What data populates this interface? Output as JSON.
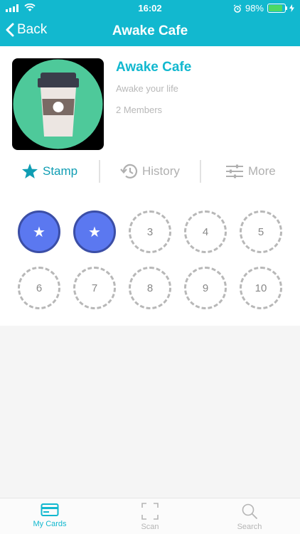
{
  "status_bar": {
    "time": "16:02",
    "battery": "98%"
  },
  "nav": {
    "back_label": "Back",
    "title": "Awake Cafe"
  },
  "cafe": {
    "name": "Awake Cafe",
    "tagline": "Awake your life",
    "members": "2 Members"
  },
  "tabs": {
    "stamp": "Stamp",
    "history": "History",
    "more": "More"
  },
  "stamps": {
    "filled_count": 2,
    "slots": [
      "★",
      "★",
      "3",
      "4",
      "5",
      "6",
      "7",
      "8",
      "9",
      "10"
    ]
  },
  "tab_bar": {
    "cards": "My Cards",
    "scan": "Scan",
    "search": "Search"
  },
  "colors": {
    "accent": "#12b8cf",
    "stamp_fill": "#5b78f0",
    "logo_circle": "#4ec99a"
  }
}
